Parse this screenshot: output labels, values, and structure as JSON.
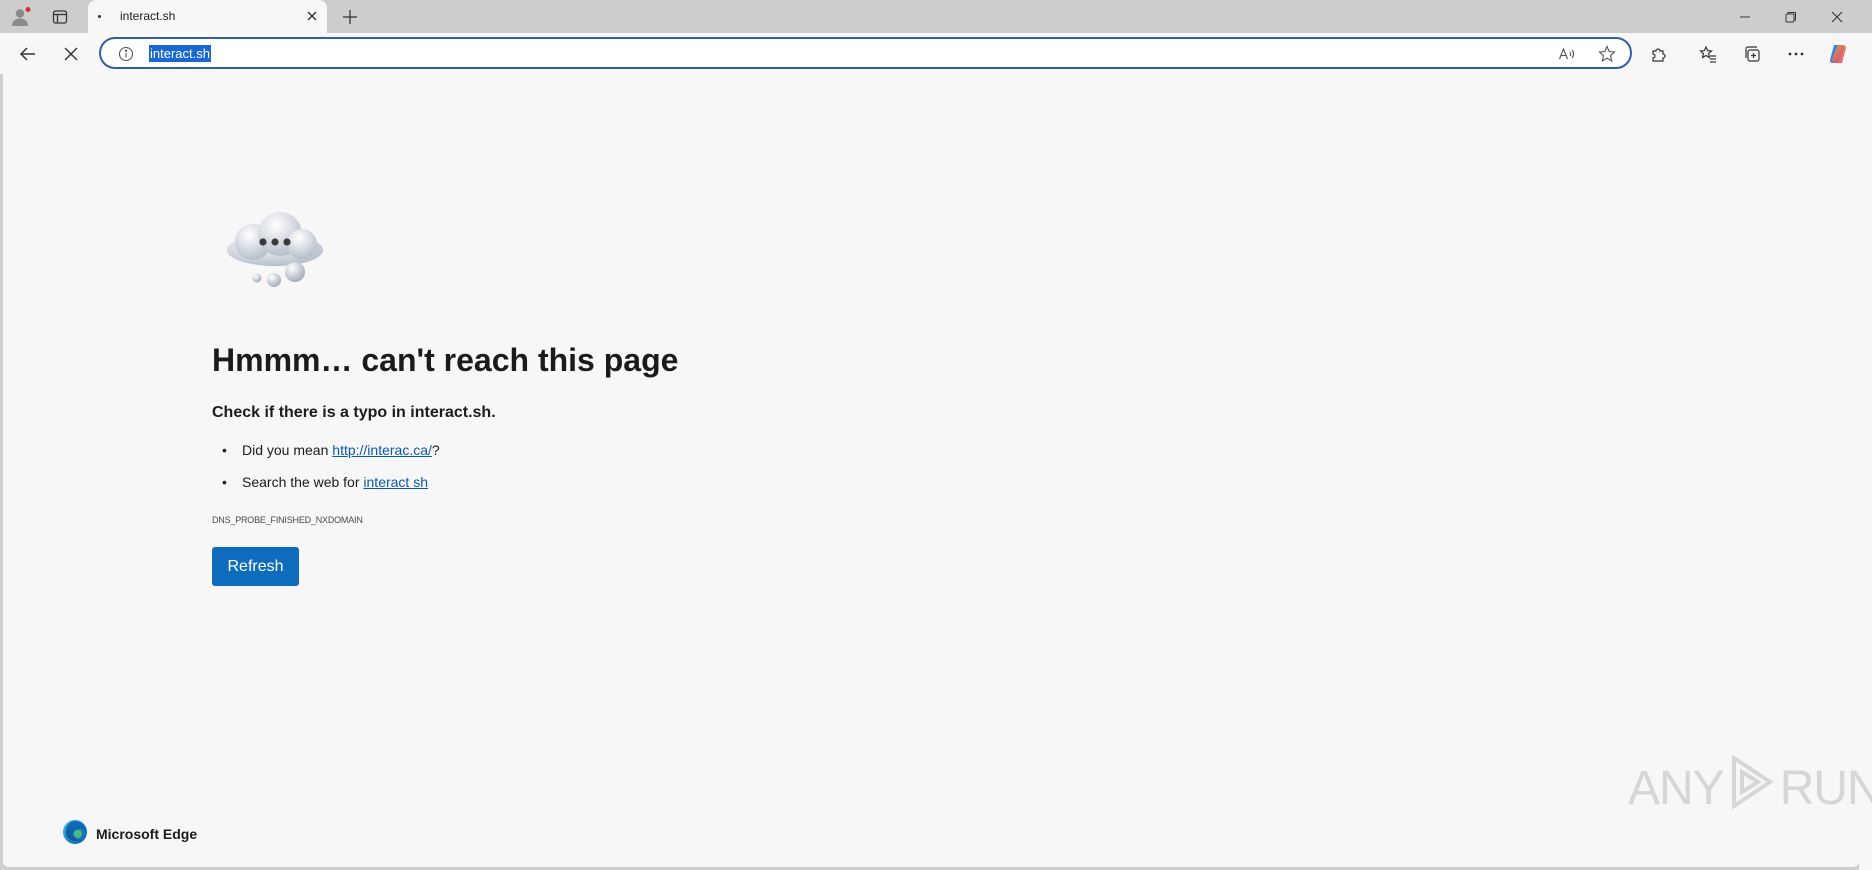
{
  "browser": {
    "tab": {
      "title": "interact.sh"
    },
    "address": {
      "url": "interact.sh"
    },
    "icons": {
      "profile": "profile-icon",
      "tab_actions": "tab-actions-icon",
      "tab_close": "close-icon",
      "new_tab": "plus-icon",
      "back": "back-arrow-icon",
      "stop": "stop-icon",
      "site_info": "info-icon",
      "read_aloud": "read-aloud-icon",
      "favorite": "star-icon",
      "extensions": "puzzle-icon",
      "favorites": "favorites-icon",
      "collections": "collections-icon",
      "more": "more-icon",
      "copilot": "copilot-icon",
      "minimize": "minimize-icon",
      "restore": "restore-icon",
      "close_window": "close-icon"
    }
  },
  "error_page": {
    "title": "Hmmm… can't reach this page",
    "subtitle": "Check if there is a typo in interact.sh.",
    "suggestion_1": {
      "prefix": "Did you mean ",
      "link": "http://interac.ca/",
      "suffix": "?"
    },
    "suggestion_2": {
      "prefix": "Search the web for ",
      "link": "interact sh"
    },
    "error_code": "DNS_PROBE_FINISHED_NXDOMAIN",
    "refresh_label": "Refresh"
  },
  "footer": {
    "brand": "Microsoft Edge"
  },
  "watermark": {
    "left": "ANY",
    "right": "RUN"
  },
  "colors": {
    "accent": "#0f6cbd",
    "link": "#0a58b0",
    "focus_ring": "#2f5fa8"
  }
}
